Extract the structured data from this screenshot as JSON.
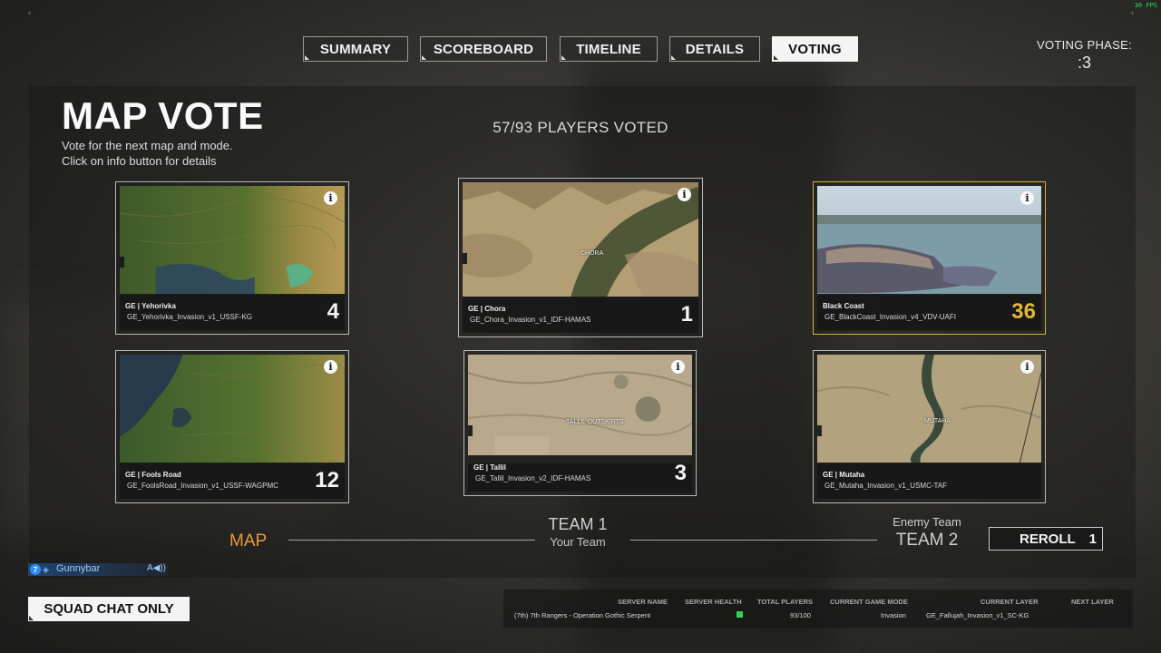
{
  "fps": "30 FPS",
  "tabs": [
    {
      "label": "SUMMARY",
      "active": false
    },
    {
      "label": "SCOREBOARD",
      "active": false
    },
    {
      "label": "TIMELINE",
      "active": false
    },
    {
      "label": "DETAILS",
      "active": false
    },
    {
      "label": "VOTING",
      "active": true
    }
  ],
  "voting_phase": {
    "label": "VOTING PHASE:",
    "value": ":3"
  },
  "header": {
    "title": "MAP VOTE",
    "subtitle_line1": "Vote for the next map and mode.",
    "subtitle_line2": "Click on info button for details",
    "players_voted": "57/93 PLAYERS VOTED"
  },
  "maps": [
    {
      "name": "GE | Yehorivka",
      "layer": "GE_Yehorivka_Invasion_v1_USSF-KG",
      "votes": "4",
      "winner": false,
      "image_label": "",
      "palette": "green"
    },
    {
      "name": "GE | Chora",
      "layer": "GE_Chora_Invasion_v1_IDF-HAMAS",
      "votes": "1",
      "winner": false,
      "image_label": "CHORA",
      "palette": "desert-valley"
    },
    {
      "name": "Black Coast",
      "layer": "GE_BlackCoast_Invasion_v4_VDV-UAFI",
      "votes": "36",
      "winner": true,
      "image_label": "",
      "palette": "coast"
    },
    {
      "name": "GE | Fools Road",
      "layer": "GE_FoolsRoad_Invasion_v1_USSF-WAGPMC",
      "votes": "12",
      "winner": false,
      "image_label": "",
      "palette": "green-water"
    },
    {
      "name": "GE | Tallil",
      "layer": "GE_Tallil_Invasion_v2_IDF-HAMAS",
      "votes": "3",
      "winner": false,
      "image_label": "TALLIL OUTSKIRTS",
      "palette": "desert"
    },
    {
      "name": "GE | Mutaha",
      "layer": "GE_Mutaha_Invasion_v1_USMC-TAF",
      "votes": "",
      "winner": false,
      "image_label": "MUTAHA",
      "palette": "desert-river"
    }
  ],
  "bottom": {
    "map_label": "MAP",
    "team1_label": "TEAM 1",
    "team1_sub": "Your Team",
    "enemy_label": "Enemy Team",
    "team2_label": "TEAM 2",
    "reroll_label": "REROLL",
    "reroll_count": "1"
  },
  "speaker": {
    "squad": "7",
    "name": "Gunnybar",
    "icon": "speaker-icon"
  },
  "squad_chat": "SQUAD CHAT ONLY",
  "server": {
    "headers": [
      "SERVER NAME",
      "SERVER HEALTH",
      "TOTAL PLAYERS",
      "CURRENT GAME MODE",
      "CURRENT LAYER",
      "NEXT LAYER"
    ],
    "server_name": "(7th) 7th Rangers - Operation Gothic Serpent",
    "total_players": "93/100",
    "game_mode": "Invasion",
    "current_layer": "GE_Fallujah_Invasion_v1_SC-KG",
    "next_layer": "",
    "health_color": "#2ed45a"
  },
  "colors": {
    "accent_orange": "#e89a3a",
    "winner_gold": "#e4b933"
  }
}
